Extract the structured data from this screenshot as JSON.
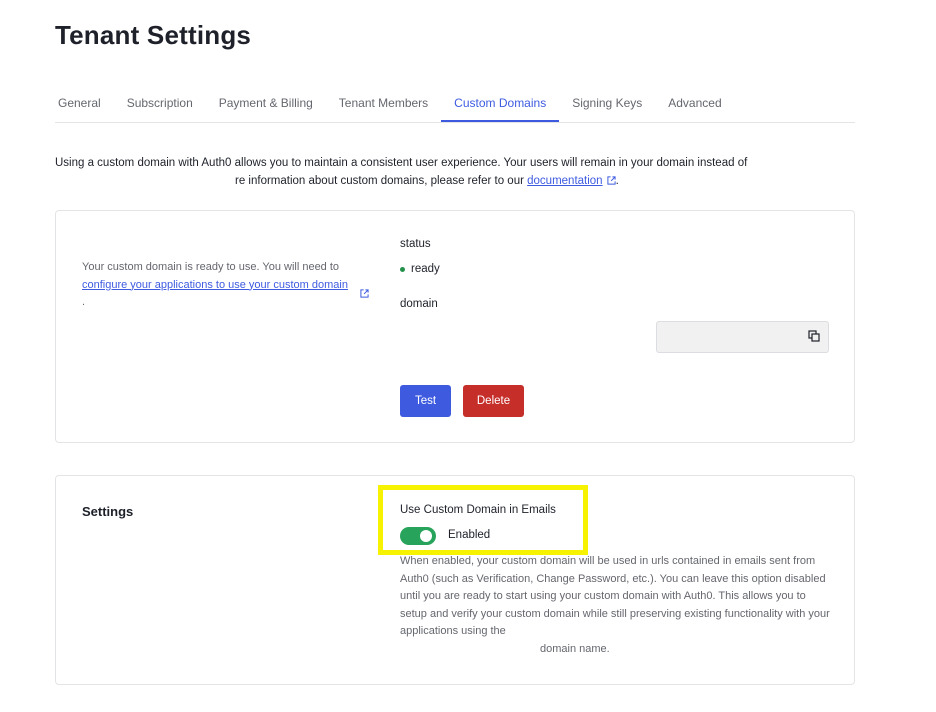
{
  "page": {
    "title": "Tenant Settings"
  },
  "tabs": [
    {
      "label": "General"
    },
    {
      "label": "Subscription"
    },
    {
      "label": "Payment & Billing"
    },
    {
      "label": "Tenant Members"
    },
    {
      "label": "Custom Domains",
      "active": true
    },
    {
      "label": "Signing Keys"
    },
    {
      "label": "Advanced"
    }
  ],
  "intro": {
    "line1": "Using a custom domain with Auth0 allows you to maintain a consistent user experience. Your users will remain in your domain instead of",
    "line2_prefix": "re information about custom domains, please refer to our",
    "link": "documentation",
    "line2_suffix": "."
  },
  "domain_card": {
    "note_prefix": "Your custom domain is ready to use. You will need to",
    "note_link": "configure your applications to use your custom domain",
    "note_suffix": ".",
    "status_label": "status",
    "status_value": "ready",
    "domain_label": "domain",
    "domain_value": "",
    "test_label": "Test",
    "delete_label": "Delete"
  },
  "settings_card": {
    "title": "Settings",
    "option_label": "Use Custom Domain in Emails",
    "toggle_state": "Enabled",
    "toggle_on": true,
    "help_text": "When enabled, your custom domain will be used in urls contained in emails sent from Auth0 (such as Verification, Change Password, etc.). You can leave this option disabled until you are ready to start using your custom domain with Auth0. This allows you to setup and verify your custom domain while still preserving existing functionality with your applications using the",
    "help_text_last": "domain name."
  },
  "colors": {
    "accent": "#3e5be0",
    "danger": "#c62e2a",
    "success": "#27a35b",
    "highlight": "#f6f200"
  },
  "icons": {
    "external_link": "external-link-icon",
    "copy": "copy-icon",
    "status_dot": "status-dot-icon"
  }
}
